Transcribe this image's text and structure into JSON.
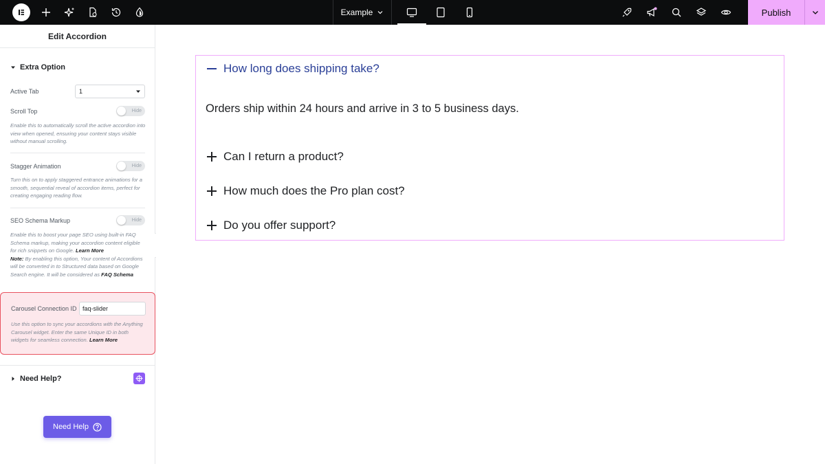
{
  "topbar": {
    "page_name": "Example",
    "publish_label": "Publish",
    "icons_left": [
      "elementor-logo-icon",
      "plus-icon",
      "sparkle-icon",
      "page-settings-icon",
      "history-icon",
      "theme-style-icon"
    ],
    "devices": [
      "desktop-icon",
      "tablet-icon",
      "mobile-icon"
    ],
    "icons_right": [
      "rocket-icon",
      "megaphone-icon",
      "search-icon",
      "layers-icon",
      "eye-icon"
    ],
    "accent": "#f0abfc"
  },
  "panel": {
    "title": "Edit Accordion",
    "section_title": "Extra Option",
    "active_tab": {
      "label": "Active Tab",
      "value": "1"
    },
    "scroll_top": {
      "label": "Scroll Top",
      "toggle": "Hide",
      "description": "Enable this to automatically scroll the active accordion into view when opened, ensuring your content stays visible without manual scrolling."
    },
    "stagger": {
      "label": "Stagger Animation",
      "toggle": "Hide",
      "description": "Turn this on to apply staggered entrance animations for a smooth, sequential reveal of accordion items, perfect for creating engaging reading flow."
    },
    "seo": {
      "label": "SEO Schema Markup",
      "toggle": "Hide",
      "desc_part1": "Enable this to boost your page SEO using built-in FAQ Schema markup, making your accordion content eligible for rich snippets on Google.",
      "learn_more": "Learn More",
      "note_label": "Note:",
      "desc_part2": "By enabling this option, Your content of Accordions will be converted in to Structured data based on Google Search engine. It will be considered as",
      "faq_schema": "FAQ Schema"
    },
    "carousel": {
      "label": "Carousel Connection ID",
      "value": "faq-slider",
      "description": "Use this option to sync your accordions with the Anything Carousel widget. Enter the same Unique ID in both widgets for seamless connection.",
      "learn_more": "Learn More"
    },
    "need_help_section": "Need Help?",
    "need_help_button": "Need Help"
  },
  "accordion": {
    "items": [
      {
        "title": "How long does shipping take?",
        "open": true,
        "content": "Orders ship within 24 hours and arrive in 3 to 5 business days."
      },
      {
        "title": "Can I return a product?",
        "open": false
      },
      {
        "title": "How much does the Pro plan cost?",
        "open": false
      },
      {
        "title": "Do you offer support?",
        "open": false
      }
    ],
    "active_color": "#2a3f97"
  }
}
